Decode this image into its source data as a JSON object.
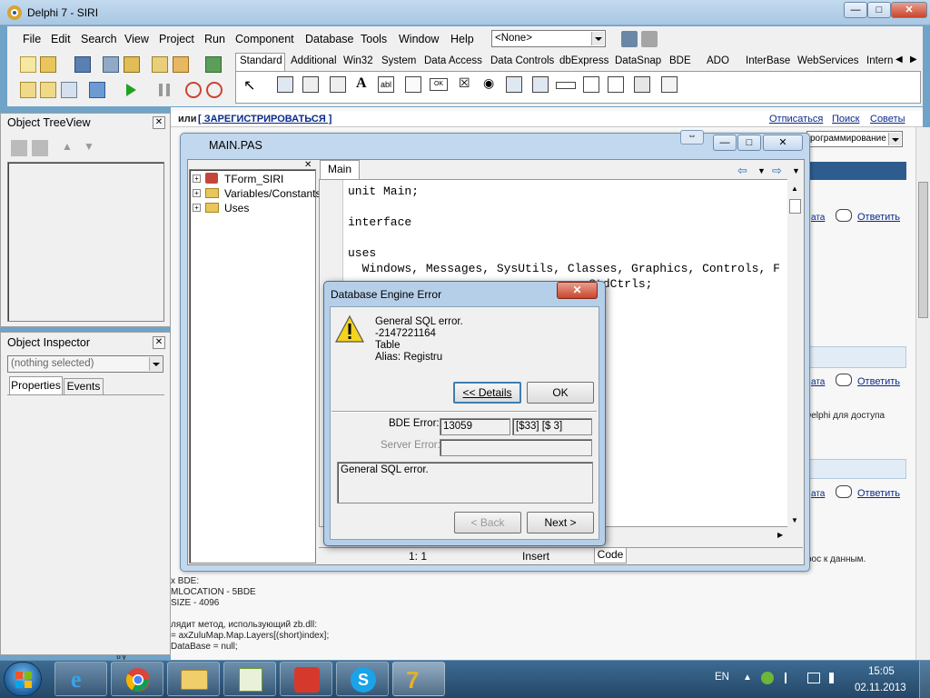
{
  "window": {
    "title": "Delphi 7 - SIRI"
  },
  "menu": [
    "File",
    "Edit",
    "Search",
    "View",
    "Project",
    "Run",
    "Component",
    "Database",
    "Tools",
    "Window",
    "Help"
  ],
  "desktop_combo": {
    "value": "<None>"
  },
  "palette_tabs": [
    "Standard",
    "Additional",
    "Win32",
    "System",
    "Data Access",
    "Data Controls",
    "dbExpress",
    "DataSnap",
    "BDE",
    "ADO",
    "InterBase",
    "WebServices",
    "Intern"
  ],
  "background_page": {
    "header_text": "или",
    "register_link": "[ ЗАРЕГИСТРИРОВАТЬСЯ ]",
    "top_links": [
      "Отписаться",
      "Поиск",
      "Советы"
    ],
    "category_select": "рограммирование",
    "reply_link": "Ответить",
    "ta_link": "ата",
    "delphi_note": "Delphi для доступа",
    "data_note": "рос к данным.",
    "snippet_lines": [
      "x BDE:",
      "MLOCATION - 5BDE",
      "SIZE - 4096",
      "лядит метод, использующий zb.dll:",
      "= axZuluMap.Map.Layers[(short)index];",
      "DataBase = null;",
      "try"
    ]
  },
  "object_treeview": {
    "title": "Object TreeView"
  },
  "object_inspector": {
    "title": "Object Inspector",
    "selector": "(nothing selected)",
    "tabs": [
      "Properties",
      "Events"
    ]
  },
  "editor": {
    "title": "MAIN.PAS",
    "tab": "Main",
    "tree": [
      "TForm_SIRI",
      "Variables/Constants",
      "Uses"
    ],
    "code": [
      "unit Main;",
      "",
      "interface",
      "",
      "uses",
      "  Windows, Messages, SysUtils, Classes, Graphics, Controls, F",
      "                                  StdCtrls;"
    ],
    "status_pos": "1:   1",
    "status_mode": "Insert",
    "bottom_tab": "Code"
  },
  "dialog": {
    "title": "Database Engine Error",
    "message": [
      "General SQL error.",
      "-2147221164",
      "Table",
      "Alias: Registru"
    ],
    "details_button": "<< Details",
    "ok_button": "OK",
    "bde_error_label": "BDE Error:",
    "bde_error_code": "13059",
    "bde_error_sub": "[$33] [$ 3]",
    "server_error_label": "Server Error:",
    "server_error_value": "",
    "detail_text": "General SQL error.",
    "back_button": "< Back",
    "next_button": "Next >"
  },
  "taskbar": {
    "language": "EN",
    "time": "15:05",
    "date": "02.11.2013"
  }
}
